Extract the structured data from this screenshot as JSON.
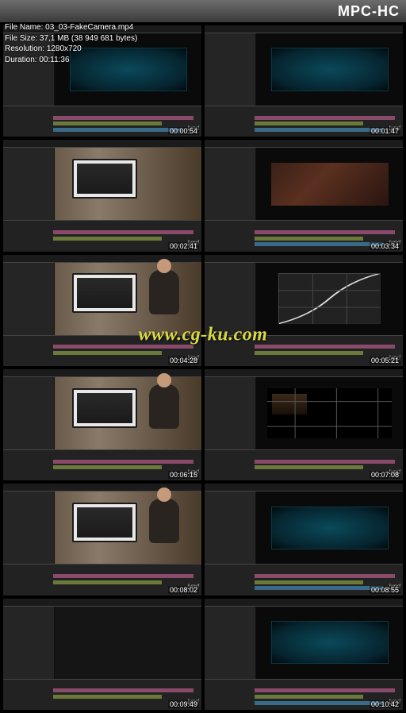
{
  "app": {
    "name": "MPC-HC"
  },
  "fileinfo": {
    "name_label": "File Name:",
    "name": "03_03-FakeCamera.mp4",
    "size_label": "File Size:",
    "size": "37,1 MB (38 949 681 bytes)",
    "res_label": "Resolution:",
    "res": "1280x720",
    "dur_label": "Duration:",
    "dur": "00:11:36"
  },
  "watermark": "www.cg-ku.com",
  "brand": "lynd",
  "thumbs": [
    {
      "ts": "00:00:54",
      "kind": "ae-teal"
    },
    {
      "ts": "00:01:47",
      "kind": "ae-teal"
    },
    {
      "ts": "00:02:41",
      "kind": "photo"
    },
    {
      "ts": "00:03:34",
      "kind": "ae-organic"
    },
    {
      "ts": "00:04:28",
      "kind": "photo"
    },
    {
      "ts": "00:05:21",
      "kind": "ae-curve"
    },
    {
      "ts": "00:06:15",
      "kind": "photo"
    },
    {
      "ts": "00:07:08",
      "kind": "ae-blackgrid"
    },
    {
      "ts": "00:08:02",
      "kind": "photo"
    },
    {
      "ts": "00:08:55",
      "kind": "ae-teal"
    },
    {
      "ts": "00:09:49",
      "kind": "ae-dark"
    },
    {
      "ts": "00:10:42",
      "kind": "ae-teal"
    }
  ]
}
